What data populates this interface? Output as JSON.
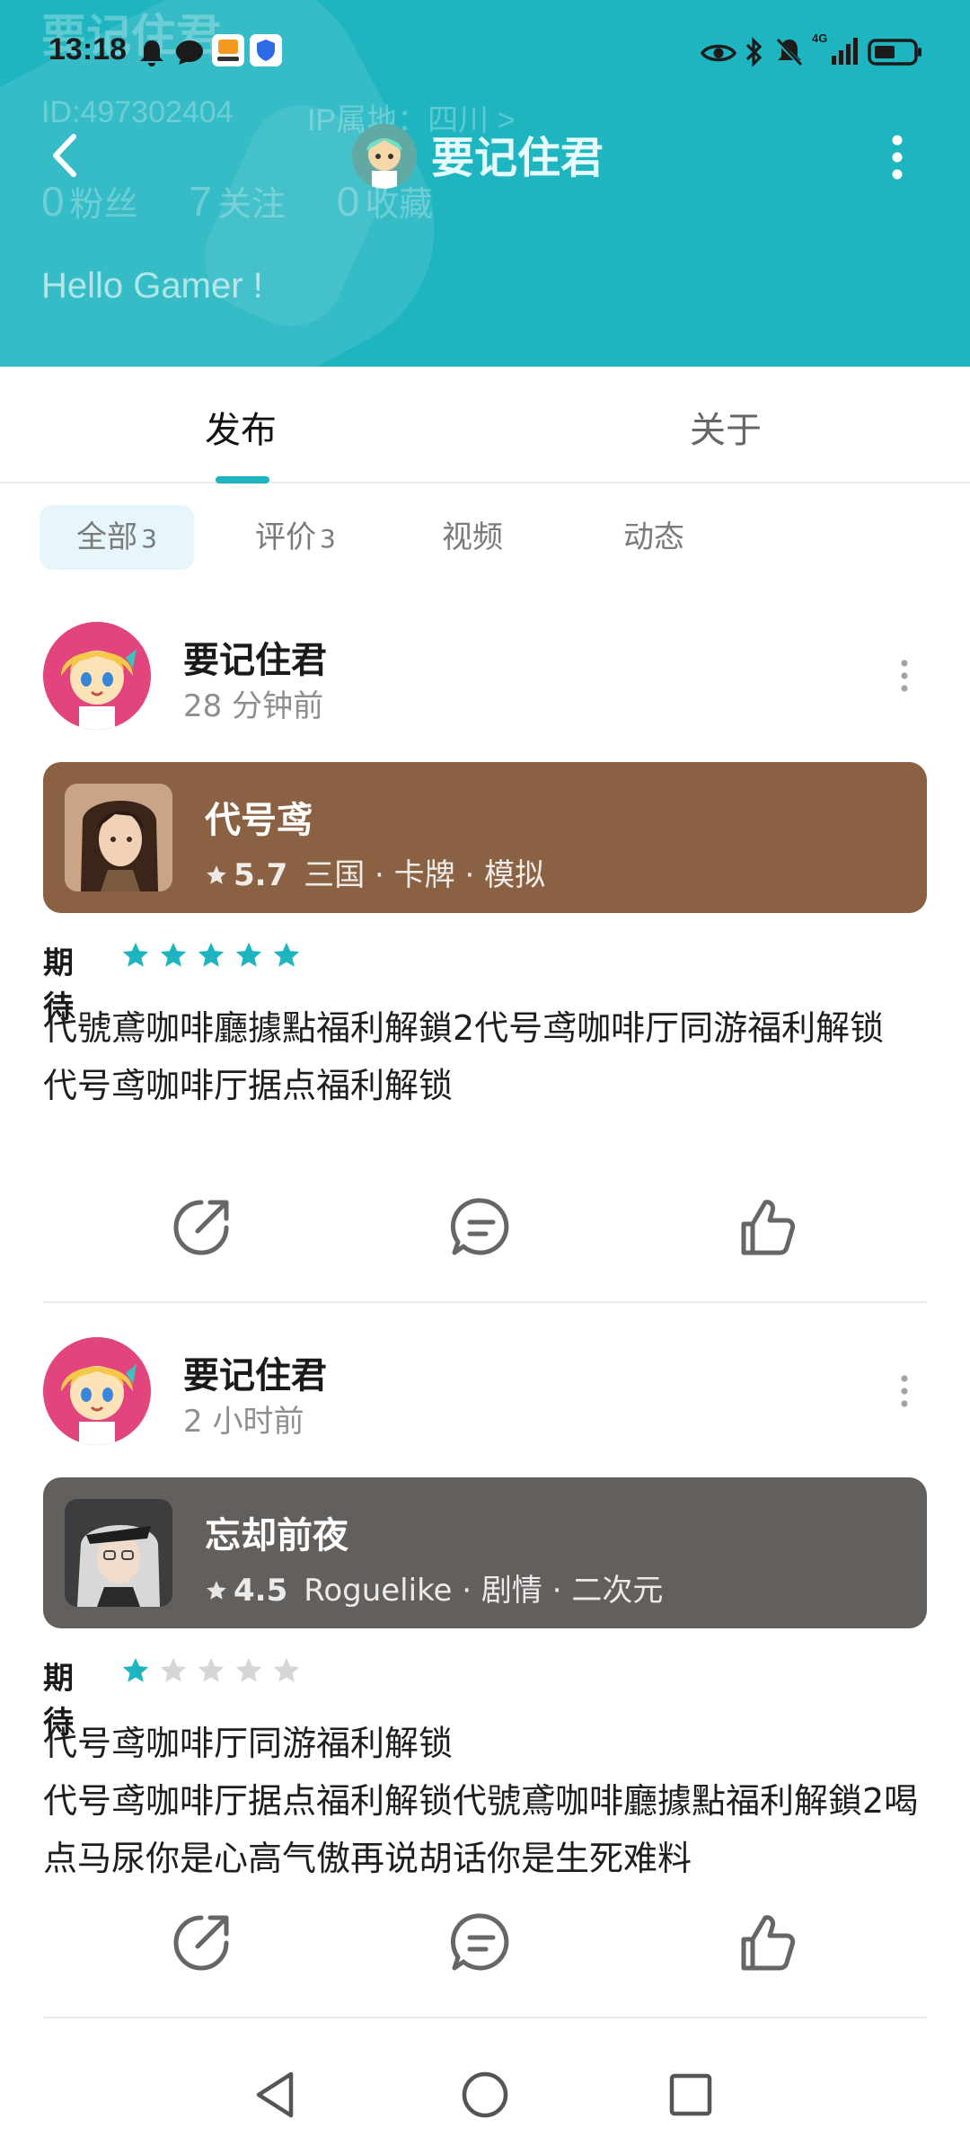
{
  "status_bar": {
    "time": "13:18",
    "icons": [
      "alarm-icon",
      "chat-icon",
      "app-icon",
      "shield-icon",
      "eye-icon",
      "bluetooth-icon",
      "mute-icon",
      "signal-icon",
      "battery-icon"
    ],
    "network": "4G"
  },
  "profile_bg": {
    "name": "要记住君",
    "id": "ID:497302404",
    "ip": "IP属地：四川 >",
    "stats": [
      {
        "value": "0",
        "label": "粉丝"
      },
      {
        "value": "7",
        "label": "关注"
      },
      {
        "value": "0",
        "label": "收藏"
      }
    ],
    "greeting": "Hello Gamer !"
  },
  "nav": {
    "title": "要记住君"
  },
  "tabs": [
    {
      "label": "发布",
      "active": true
    },
    {
      "label": "关于",
      "active": false
    }
  ],
  "filters": [
    {
      "label": "全部",
      "count": "3",
      "active": true
    },
    {
      "label": "评价",
      "count": "3",
      "active": false
    },
    {
      "label": "视频",
      "count": "",
      "active": false
    },
    {
      "label": "动态",
      "count": "",
      "active": false
    }
  ],
  "posts": [
    {
      "user": "要记住君",
      "time": "28 分钟前",
      "game": {
        "name": "代号鸢",
        "score": "5.7",
        "tags": "三国 · 卡牌 · 模拟",
        "color": "#8a6142"
      },
      "rating_label": "期待",
      "stars": 5,
      "lines": [
        "代號鳶咖啡廳據點福利解鎖2代号鸢咖啡厅同游福利解锁",
        "代号鸢咖啡厅据点福利解锁"
      ]
    },
    {
      "user": "要记住君",
      "time": "2 小时前",
      "game": {
        "name": "忘却前夜",
        "score": "4.5",
        "tags": "Roguelike · 剧情 · 二次元",
        "color": "#635f5c"
      },
      "rating_label": "期待",
      "stars": 1,
      "lines": [
        "代号鸢咖啡厅同游福利解锁",
        "代号鸢咖啡厅据点福利解锁代號鳶咖啡廳據點福利解鎖2喝点马尿你是心高气傲再说胡话你是生死难料"
      ]
    }
  ],
  "colors": {
    "accent": "#1fb5c0",
    "star_on": "#1fb5c0",
    "star_off": "#d6d6d6"
  }
}
